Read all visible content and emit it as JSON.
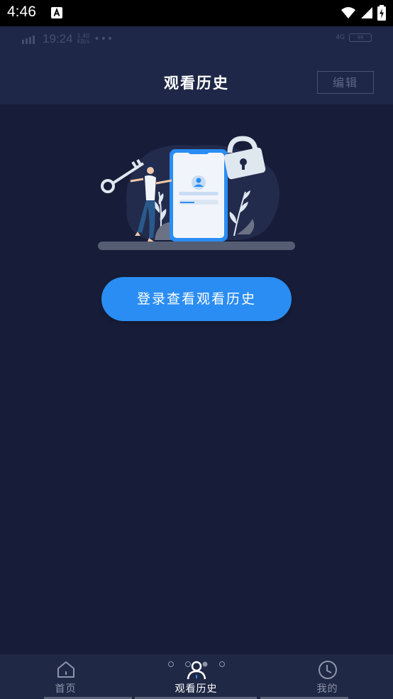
{
  "status_bar": {
    "time": "4:46"
  },
  "ghost_status": {
    "network": "4GHD",
    "time": "19:24",
    "speed_value": "1.40",
    "speed_unit": "KB/s",
    "dots": "•••",
    "right_network": "4G",
    "battery": "98"
  },
  "header": {
    "title": "观看历史",
    "edit_label": "编辑"
  },
  "main": {
    "login_button_label": "登录查看观看历史",
    "illustration": "login-lock-key-phone-illustration"
  },
  "tabbar": {
    "tabs": [
      {
        "label": "首页",
        "icon": "home-icon",
        "active": false
      },
      {
        "label": "观看历史",
        "icon": "user-icon",
        "active": true
      },
      {
        "label": "我的",
        "icon": "clock-icon",
        "active": false
      }
    ]
  },
  "colors": {
    "background": "#171d38",
    "appbar": "#1e2747",
    "accent": "#2a8df3",
    "tabbar": "#1f2844"
  }
}
